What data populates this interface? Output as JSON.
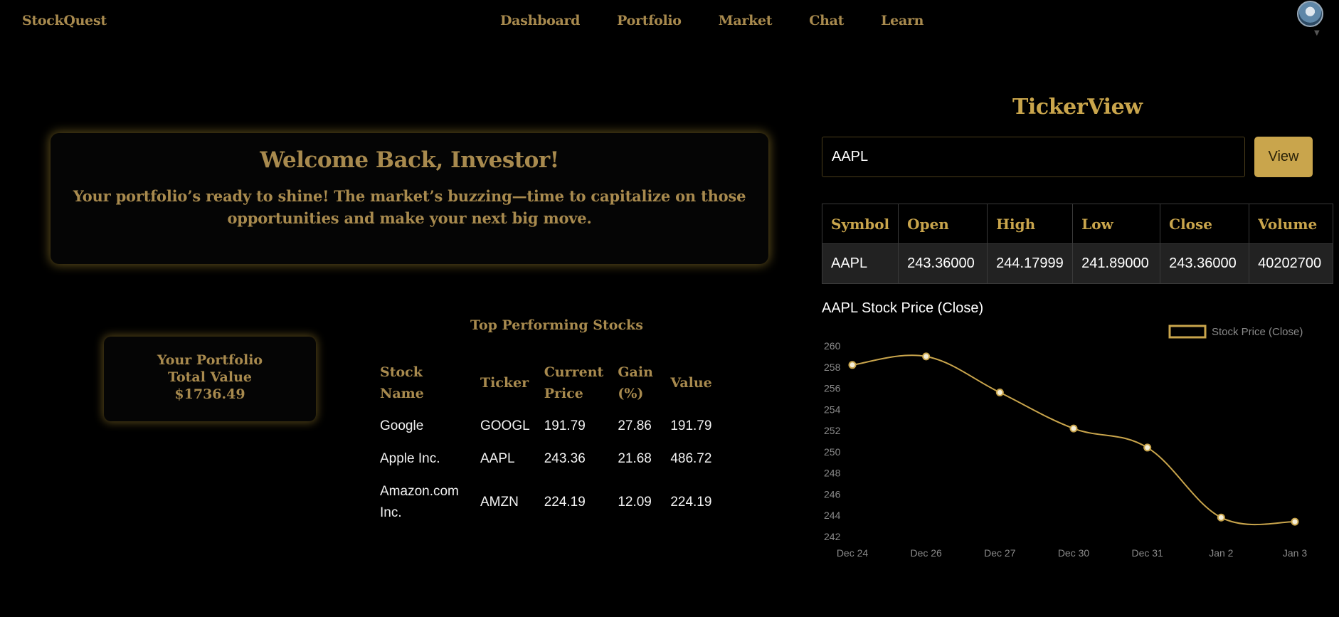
{
  "nav": {
    "brand": "StockQuest",
    "links": [
      "Dashboard",
      "Portfolio",
      "Market",
      "Chat",
      "Learn"
    ],
    "avatar_icon": "user-avatar",
    "caret_icon": "caret-down-icon"
  },
  "welcome": {
    "title": "Welcome Back, Investor!",
    "message": "Your portfolio’s ready to shine! The market’s buzzing—time to capitalize on those opportunities and make your next big move."
  },
  "portfolio": {
    "line1": "Your Portfolio",
    "line2": "Total Value",
    "value": "$1736.49"
  },
  "top_stocks": {
    "title": "Top Performing Stocks",
    "headers": [
      "Stock Name",
      "Ticker",
      "Current Price",
      "Gain (%)",
      "Value"
    ],
    "rows": [
      [
        "Google",
        "GOOGL",
        "191.79",
        "27.86",
        "191.79"
      ],
      [
        "Apple Inc.",
        "AAPL",
        "243.36",
        "21.68",
        "486.72"
      ],
      [
        "Amazon.com Inc.",
        "AMZN",
        "224.19",
        "12.09",
        "224.19"
      ]
    ]
  },
  "ticker": {
    "title": "TickerView",
    "input_value": "AAPL",
    "button_label": "View",
    "table_headers": [
      "Symbol",
      "Open",
      "High",
      "Low",
      "Close",
      "Volume"
    ],
    "table_row": [
      "AAPL",
      "243.36000",
      "244.17999",
      "241.89000",
      "243.36000",
      "40202700"
    ]
  },
  "colors": {
    "accent": "#a88a4e",
    "gold": "#c9a54c",
    "background": "#000000"
  },
  "chart_data": {
    "type": "line",
    "title": "AAPL Stock Price (Close)",
    "x": [
      "Dec 24",
      "Dec 26",
      "Dec 27",
      "Dec 30",
      "Dec 31",
      "Jan 2",
      "Jan 3"
    ],
    "series": [
      {
        "name": "Stock Price (Close)",
        "values": [
          258.2,
          259.0,
          255.6,
          252.2,
          250.4,
          243.8,
          243.4
        ]
      }
    ],
    "y_ticks": [
      242,
      244,
      246,
      248,
      250,
      252,
      254,
      256,
      258,
      260
    ],
    "ylim": [
      242,
      260
    ],
    "grid": false,
    "legend": "top-right"
  }
}
